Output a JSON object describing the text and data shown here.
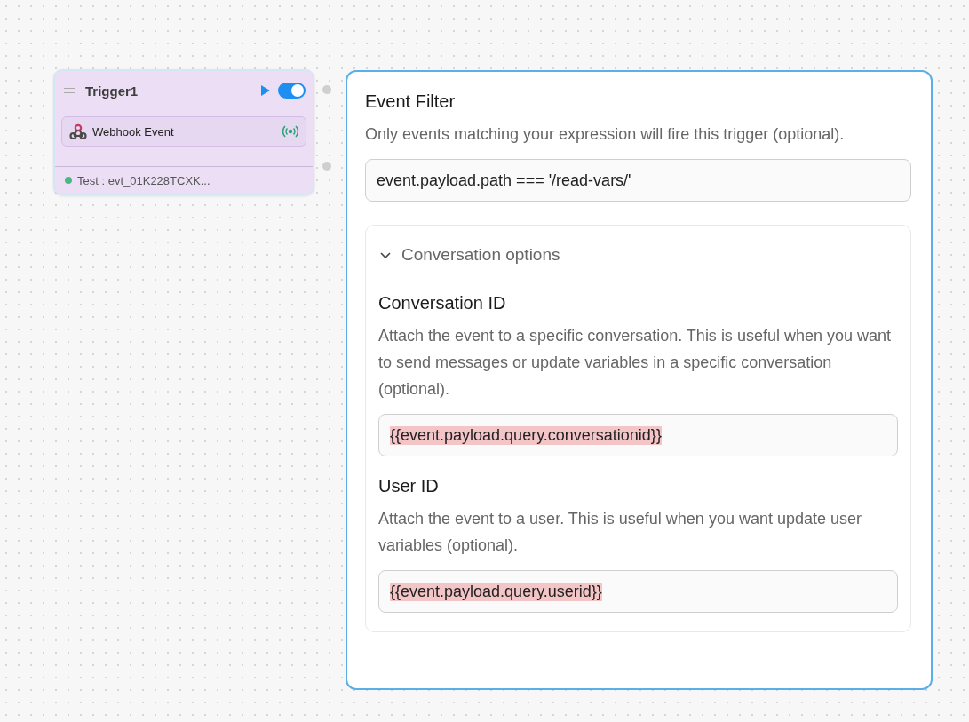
{
  "node": {
    "title": "Trigger1",
    "enabled": true,
    "source": {
      "label": "Webhook Event"
    },
    "test": {
      "label": "Test : evt_01K228TCXK..."
    }
  },
  "panel": {
    "filter": {
      "title": "Event Filter",
      "description": "Only events matching your expression will fire this trigger (optional).",
      "value": "event.payload.path === '/read-vars/'"
    },
    "options": {
      "title": "Conversation options",
      "expanded": true,
      "fields": [
        {
          "label": "Conversation ID",
          "description": "Attach the event to a specific conversation. This is useful when you want to send messages or update variables in a specific conversation (optional).",
          "value": "{{event.payload.query.conversationid}}"
        },
        {
          "label": "User ID",
          "description": "Attach the event to a user. This is useful when you want update user variables (optional).",
          "value": "{{event.payload.query.userid}}"
        }
      ]
    }
  }
}
